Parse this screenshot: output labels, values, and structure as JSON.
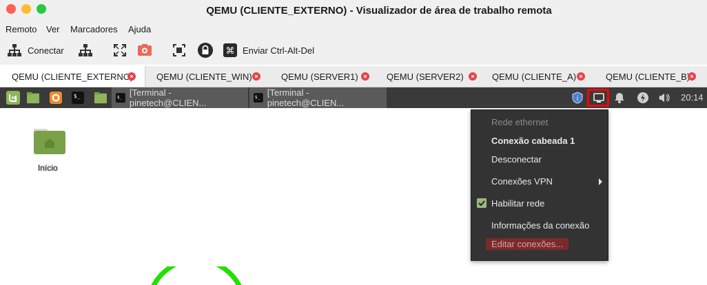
{
  "window": {
    "title": "QEMU (CLIENTE_EXTERNO) - Visualizador de área de trabalho remota"
  },
  "menubar": {
    "items": [
      "Remoto",
      "Ver",
      "Marcadores",
      "Ajuda"
    ]
  },
  "toolbar": {
    "connect_label": "Conectar",
    "ctrl_alt_del_label": "Enviar Ctrl-Alt-Del",
    "icons": [
      "network-icon",
      "network-icon",
      "fullscreen-icon",
      "screenshot-icon",
      "screen-select-icon",
      "lock-icon",
      "command-key-icon"
    ]
  },
  "tabs": [
    {
      "label": "QEMU (CLIENTE_EXTERNO)",
      "active": true
    },
    {
      "label": "QEMU (CLIENTE_WIN)",
      "active": false
    },
    {
      "label": "QEMU (SERVER1)",
      "active": false
    },
    {
      "label": "QEMU (SERVER2)",
      "active": false
    },
    {
      "label": "QEMU (CLIENTE_A)",
      "active": false
    },
    {
      "label": "QEMU (CLIENTE_B)",
      "active": false
    }
  ],
  "panel": {
    "tasks": [
      "[Terminal - pinetech@CLIEN...",
      "[Terminal - pinetech@CLIEN..."
    ],
    "clock": "20:14"
  },
  "desktop": {
    "folder_label": "Início"
  },
  "network_menu": {
    "items": [
      {
        "label": "Rede ethernet",
        "state": "disabled"
      },
      {
        "label": "Conexão cabeada 1",
        "state": "bold"
      },
      {
        "label": "Desconectar",
        "state": "normal"
      },
      {
        "label": "Conexões VPN",
        "state": "submenu"
      },
      {
        "label": "Habilitar rede",
        "state": "checked"
      },
      {
        "label": "Informações da conexão",
        "state": "normal"
      },
      {
        "label": "Editar conexões...",
        "state": "highlighted"
      }
    ]
  },
  "colors": {
    "panel_bg": "#3a3a3a",
    "menu_bg": "#333333",
    "highlight_border": "#ff0000",
    "accent_green": "#8fb45b",
    "circle_green": "#22e000"
  }
}
